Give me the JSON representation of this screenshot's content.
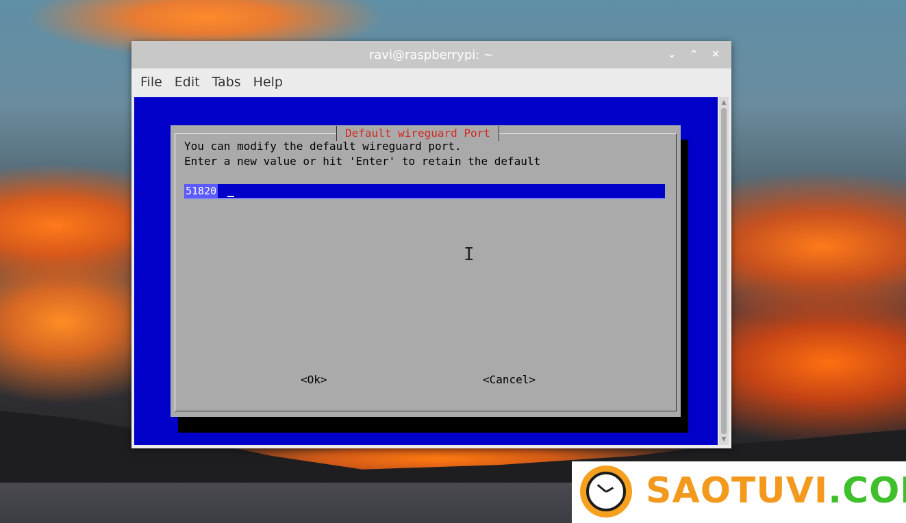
{
  "window": {
    "title": "ravi@raspberrypi: ~",
    "controls": {
      "minimize": "⌄",
      "maximize": "⌃",
      "close": "✕"
    }
  },
  "menubar": {
    "items": [
      "File",
      "Edit",
      "Tabs",
      "Help"
    ]
  },
  "dialog": {
    "title": "Default wireguard Port",
    "message_line1": "You can modify the default wireguard port.",
    "message_line2": "Enter a new value or hit 'Enter' to retain the default",
    "input_value": "51820",
    "ok_label": "<Ok>",
    "cancel_label": "<Cancel>"
  },
  "colors": {
    "terminal_bg": "#0000c8",
    "dialog_bg": "#aaaaaa",
    "title_color": "#d3271f"
  },
  "watermark": {
    "brand_a": "SAOTUVI",
    "brand_b": ".COM"
  }
}
